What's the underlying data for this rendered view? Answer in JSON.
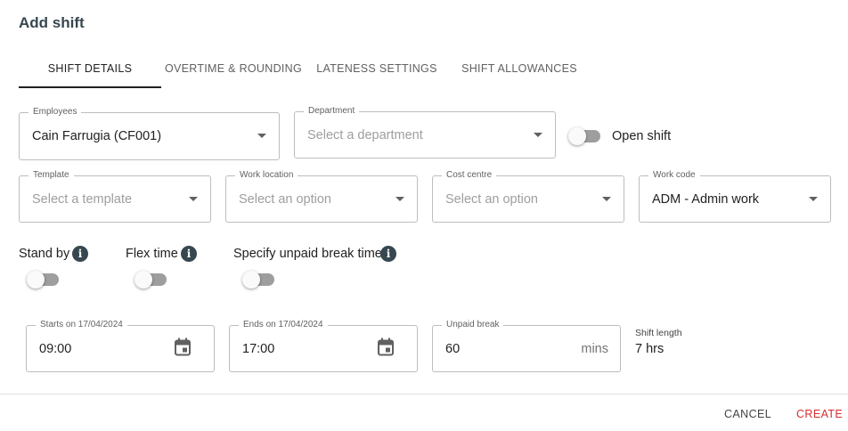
{
  "dialog": {
    "title": "Add shift"
  },
  "tabs": [
    {
      "label": "SHIFT DETAILS"
    },
    {
      "label": "OVERTIME & ROUNDING"
    },
    {
      "label": "LATENESS SETTINGS"
    },
    {
      "label": "SHIFT ALLOWANCES"
    }
  ],
  "fields": {
    "employees": {
      "label": "Employees",
      "value": "Cain Farrugia (CF001)"
    },
    "department": {
      "label": "Department",
      "placeholder": "Select a department"
    },
    "template": {
      "label": "Template",
      "placeholder": "Select a template"
    },
    "work_location": {
      "label": "Work location",
      "placeholder": "Select an option"
    },
    "cost_centre": {
      "label": "Cost centre",
      "placeholder": "Select an option"
    },
    "work_code": {
      "label": "Work code",
      "value": "ADM - Admin work"
    },
    "starts": {
      "label": "Starts on 17/04/2024",
      "value": "09:00"
    },
    "ends": {
      "label": "Ends on 17/04/2024",
      "value": "17:00"
    },
    "unpaid_break": {
      "label": "Unpaid break",
      "value": "60",
      "suffix": "mins"
    }
  },
  "toggles": {
    "open_shift": {
      "label": "Open shift",
      "on": false
    },
    "stand_by": {
      "label": "Stand by",
      "on": false
    },
    "flex_time": {
      "label": "Flex time",
      "on": false
    },
    "unpaid_break_time": {
      "label": "Specify unpaid break time",
      "on": false
    }
  },
  "shift_length": {
    "label": "Shift length",
    "value": "7 hrs"
  },
  "actions": {
    "cancel": "CANCEL",
    "create": "CREATE"
  },
  "colors": {
    "accent": "#d32f2f",
    "toggle_track": "#9e9e9e",
    "info_icon": "#37474f"
  }
}
